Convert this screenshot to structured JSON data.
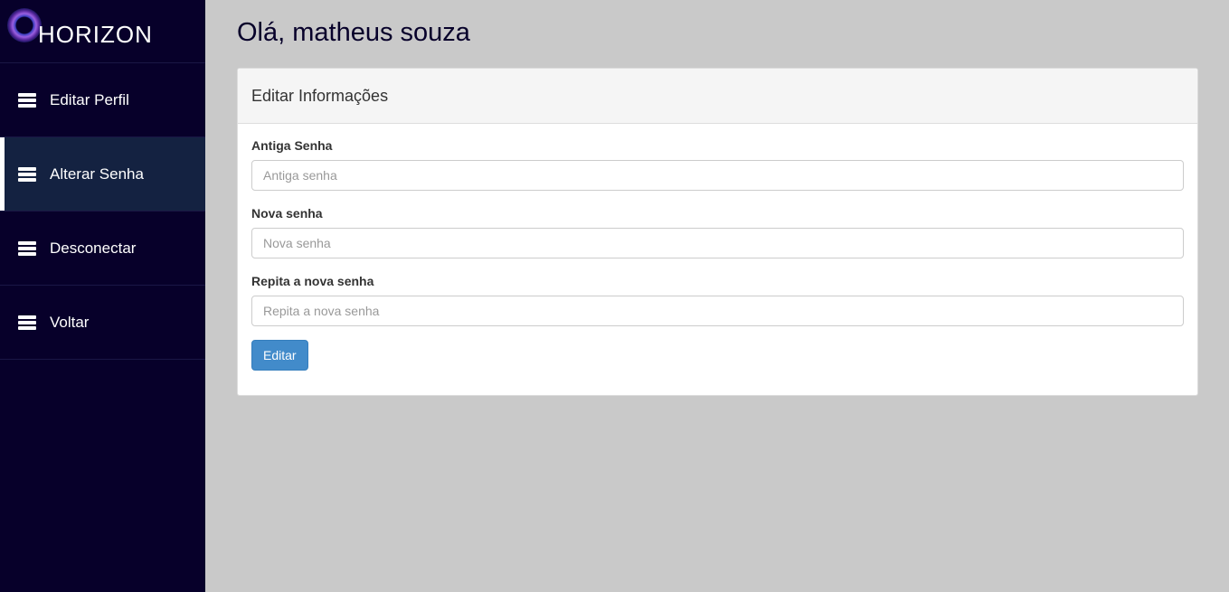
{
  "brand": {
    "name": "HORIZON"
  },
  "sidebar": {
    "items": [
      {
        "label": "Editar Perfil",
        "icon": "list-icon"
      },
      {
        "label": "Alterar Senha",
        "icon": "list-icon",
        "active": true
      },
      {
        "label": "Desconectar",
        "icon": "list-icon"
      },
      {
        "label": "Voltar",
        "icon": "list-icon"
      }
    ]
  },
  "header": {
    "greeting": "Olá, matheus souza"
  },
  "panel": {
    "title": "Editar Informações",
    "fields": [
      {
        "label": "Antiga Senha",
        "placeholder": "Antiga senha"
      },
      {
        "label": "Nova senha",
        "placeholder": "Nova senha"
      },
      {
        "label": "Repita a nova senha",
        "placeholder": "Repita a nova senha"
      }
    ],
    "submit_label": "Editar"
  },
  "colors": {
    "sidebar_bg": "#07002a",
    "active_bg": "#142241",
    "page_bg": "#c9c9c9",
    "button": "#428bca"
  }
}
